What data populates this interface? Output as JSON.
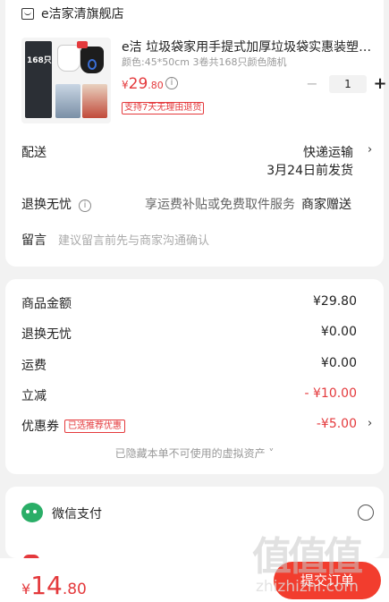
{
  "store": {
    "name": "e洁家清旗舰店",
    "icon": "store-icon"
  },
  "product": {
    "title": "e洁 垃圾袋家用手提式加厚垃圾袋实惠装塑料袋",
    "spec": "颜色:45*50cm 3卷共168只颜色随机",
    "price_yen": "¥",
    "price_int": "29",
    "price_dec": ".80",
    "info_glyph": "i",
    "return_tag": "支持7天无理由退货",
    "thumbnail_text": "168只",
    "quantity": "1",
    "minus_label": "−",
    "plus_label": "+"
  },
  "delivery": {
    "label": "配送",
    "method": "快递运输",
    "ship_date": "3月24日前发货",
    "chevron": "›"
  },
  "worry_free": {
    "label": "退换无忧",
    "info_glyph": "i",
    "desc": "享运费补贴或免费取件服务",
    "value": "商家赠送"
  },
  "message": {
    "label": "留言",
    "placeholder": "建议留言前先与商家沟通确认"
  },
  "summary": {
    "rows": [
      {
        "label": "商品金额",
        "value": "¥29.80"
      },
      {
        "label": "退换无忧",
        "value": "¥0.00"
      },
      {
        "label": "运费",
        "value": "¥0.00"
      },
      {
        "label": "立减",
        "value": "- ¥10.00"
      },
      {
        "label": "优惠券",
        "value": "-¥5.00"
      }
    ],
    "coupon_tag": "已选推荐优惠",
    "coupon_chevron": "›",
    "hidden_assets": "已隐藏本单不可使用的虚拟资产 ˅"
  },
  "payment": {
    "wechat_label": "微信支付",
    "icon": "wechat-pay-icon"
  },
  "footer": {
    "total_yen": "¥",
    "total_int": "14",
    "total_dec": ".80",
    "submit_label": "提交订单"
  },
  "watermark": {
    "logo_text": "值值值",
    "url": "zhizhizhi.com"
  },
  "colors": {
    "accent": "#e4393c",
    "submit": "#f23d2e",
    "wechat": "#2aae67",
    "background": "#f2f2f2"
  }
}
